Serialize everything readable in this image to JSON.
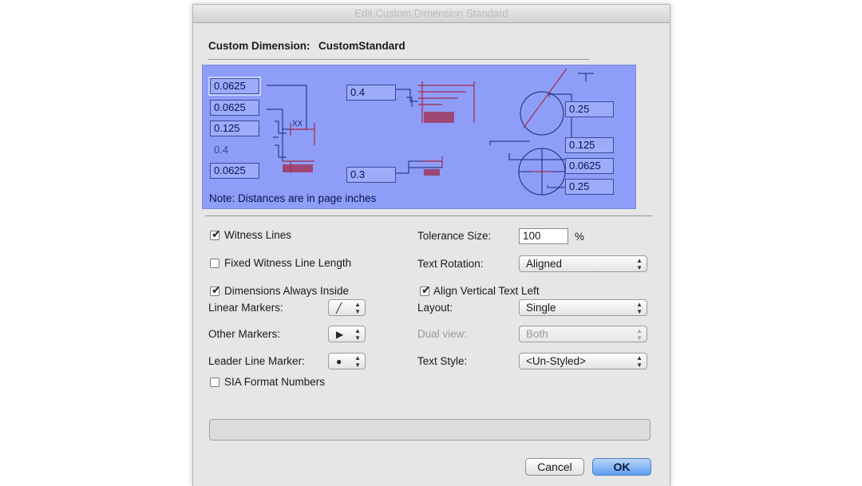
{
  "window": {
    "title": "Edit Custom Dimension Standard"
  },
  "header": {
    "label": "Custom Dimension:",
    "value": "CustomStandard"
  },
  "preview": {
    "left_fields": [
      "0.0625",
      "0.0625",
      "0.125",
      "0.4",
      "0.0625"
    ],
    "marker_text": "XX",
    "mid_fields": [
      "0.4",
      "0.3"
    ],
    "right_fields": [
      "0.25",
      "0.125",
      "0.0625",
      "0.25"
    ],
    "note": "Note: Distances are in page inches"
  },
  "options": {
    "witness_lines": {
      "label": "Witness Lines",
      "checked": true
    },
    "fixed_witness": {
      "label": "Fixed Witness Line Length",
      "checked": false
    },
    "dims_inside": {
      "label": "Dimensions Always Inside",
      "checked": true
    },
    "linear_markers": {
      "label": "Linear Markers:",
      "icon": "slash-marker-icon"
    },
    "other_markers": {
      "label": "Other Markers:",
      "icon": "arrow-marker-icon"
    },
    "leader_marker": {
      "label": "Leader Line Marker:",
      "icon": "dot-marker-icon"
    },
    "sia_format": {
      "label": "SIA Format Numbers",
      "checked": false
    },
    "tolerance": {
      "label": "Tolerance Size:",
      "value": "100",
      "unit": "%"
    },
    "text_rotation": {
      "label": "Text Rotation:",
      "value": "Aligned"
    },
    "align_vertical": {
      "label": "Align Vertical Text Left",
      "checked": true
    },
    "layout": {
      "label": "Layout:",
      "value": "Single"
    },
    "dual_view": {
      "label": "Dual view:",
      "value": "Both"
    },
    "text_style": {
      "label": "Text Style:",
      "value": "<Un-Styled>"
    }
  },
  "buttons": {
    "cancel": "Cancel",
    "ok": "OK"
  },
  "colors": {
    "preview_bg": "#8e9ef8",
    "dim_red": "#a32a46",
    "ok_blue": "#5f9ef2"
  }
}
